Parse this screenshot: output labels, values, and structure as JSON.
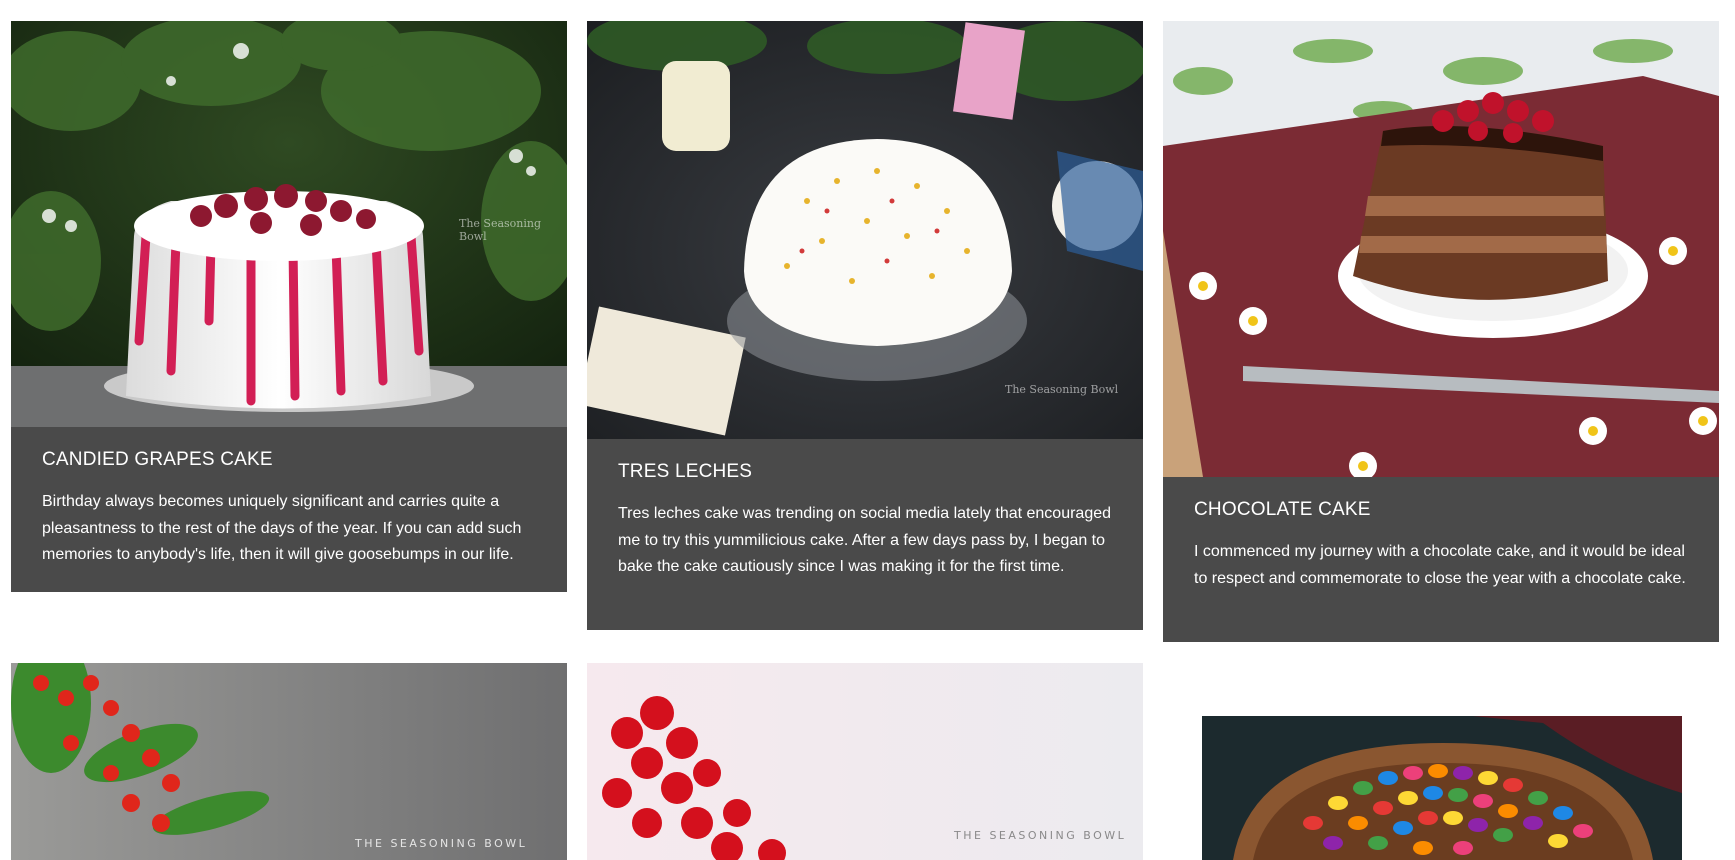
{
  "cards": [
    {
      "title": "CANDIED GRAPES CAKE",
      "description": "Birthday always becomes uniquely significant and carries quite a pleasantness to the rest of the days of the year. If you can add such memories to anybody's life, then it will give goosebumps in our life.",
      "watermark": "The Seasoning Bowl",
      "image": "candied-grapes-cake-photo"
    },
    {
      "title": "TRES LECHES",
      "description": "Tres leches cake was trending on social media lately that encouraged me to try this yummilicious cake. After a few days pass by, I began to bake the cake cautiously since I was making it for the first time.",
      "watermark": "The Seasoning Bowl",
      "image": "tres-leches-cake-photo"
    },
    {
      "title": "CHOCOLATE CAKE",
      "description": "I commenced my journey with a chocolate cake, and it would be ideal to respect and commemorate to close the year with a chocolate cake.",
      "image": "chocolate-cake-photo"
    },
    {
      "watermark": "THE SEASONING BOWL",
      "image": "red-berries-cake-photo"
    },
    {
      "watermark": "THE SEASONING BOWL",
      "image": "red-flowers-cake-photo"
    },
    {
      "image": "gems-candy-cake-photo"
    }
  ]
}
